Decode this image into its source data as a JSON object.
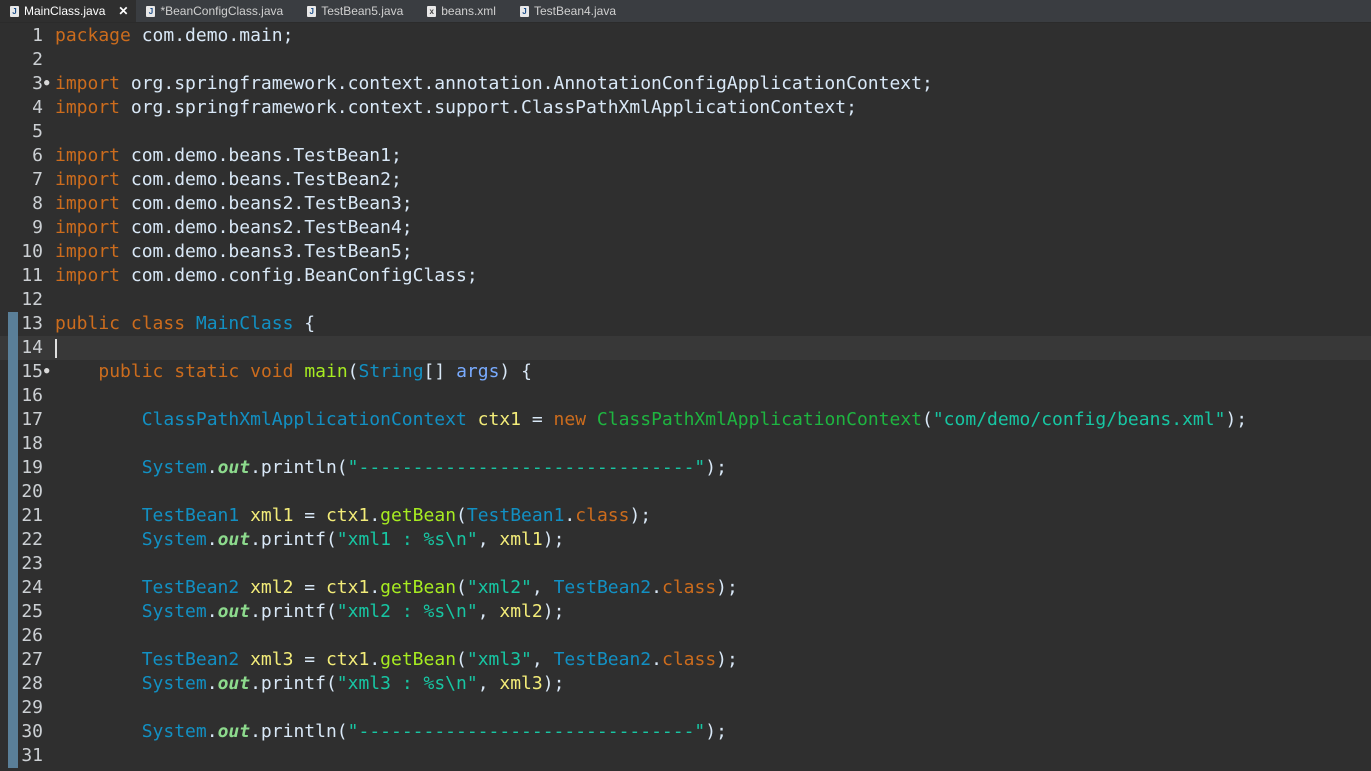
{
  "tabs": [
    {
      "label": "MainClass.java",
      "icon": "java-file-icon",
      "active": true
    },
    {
      "label": "*BeanConfigClass.java",
      "icon": "java-file-icon",
      "active": false
    },
    {
      "label": "TestBean5.java",
      "icon": "java-file-icon",
      "active": false
    },
    {
      "label": "beans.xml",
      "icon": "xml-file-icon",
      "active": false
    },
    {
      "label": "TestBean4.java",
      "icon": "java-file-icon",
      "active": false
    }
  ],
  "editor": {
    "current_line": 14,
    "lines": [
      {
        "n": "1",
        "tokens": [
          [
            "kw",
            "package"
          ],
          [
            "p",
            " com.demo.main;"
          ]
        ]
      },
      {
        "n": "2",
        "tokens": []
      },
      {
        "n": "3",
        "fold": true,
        "tokens": [
          [
            "kw",
            "import"
          ],
          [
            "p",
            " org.springframework.context.annotation.AnnotationConfigApplicationContext;"
          ]
        ]
      },
      {
        "n": "4",
        "tokens": [
          [
            "kw",
            "import"
          ],
          [
            "p",
            " org.springframework.context.support.ClassPathXmlApplicationContext;"
          ]
        ]
      },
      {
        "n": "5",
        "tokens": []
      },
      {
        "n": "6",
        "tokens": [
          [
            "kw",
            "import"
          ],
          [
            "p",
            " com.demo.beans.TestBean1;"
          ]
        ]
      },
      {
        "n": "7",
        "tokens": [
          [
            "kw",
            "import"
          ],
          [
            "p",
            " com.demo.beans.TestBean2;"
          ]
        ]
      },
      {
        "n": "8",
        "tokens": [
          [
            "kw",
            "import"
          ],
          [
            "p",
            " com.demo.beans2.TestBean3;"
          ]
        ]
      },
      {
        "n": "9",
        "tokens": [
          [
            "kw",
            "import"
          ],
          [
            "p",
            " com.demo.beans2.TestBean4;"
          ]
        ]
      },
      {
        "n": "10",
        "tokens": [
          [
            "kw",
            "import"
          ],
          [
            "p",
            " com.demo.beans3.TestBean5;"
          ]
        ]
      },
      {
        "n": "11",
        "tokens": [
          [
            "kw",
            "import"
          ],
          [
            "p",
            " com.demo.config.BeanConfigClass;"
          ]
        ]
      },
      {
        "n": "12",
        "tokens": []
      },
      {
        "n": "13",
        "tokens": [
          [
            "kw",
            "public"
          ],
          [
            "p",
            " "
          ],
          [
            "kw",
            "class"
          ],
          [
            "p",
            " "
          ],
          [
            "ty",
            "MainClass"
          ],
          [
            "p",
            " {"
          ]
        ]
      },
      {
        "n": "14",
        "tokens": []
      },
      {
        "n": "15",
        "fold": true,
        "tokens": [
          [
            "p",
            "    "
          ],
          [
            "kw",
            "public"
          ],
          [
            "p",
            " "
          ],
          [
            "kw",
            "static"
          ],
          [
            "p",
            " "
          ],
          [
            "kw",
            "void"
          ],
          [
            "p",
            " "
          ],
          [
            "fn",
            "main"
          ],
          [
            "p",
            "("
          ],
          [
            "ty",
            "String"
          ],
          [
            "p",
            "[] "
          ],
          [
            "arg",
            "args"
          ],
          [
            "p",
            ") {"
          ]
        ]
      },
      {
        "n": "16",
        "tokens": []
      },
      {
        "n": "17",
        "tokens": [
          [
            "p",
            "        "
          ],
          [
            "ty",
            "ClassPathXmlApplicationContext"
          ],
          [
            "p",
            " "
          ],
          [
            "var",
            "ctx1"
          ],
          [
            "p",
            " = "
          ],
          [
            "kw",
            "new"
          ],
          [
            "p",
            " "
          ],
          [
            "cls",
            "ClassPathXmlApplicationContext"
          ],
          [
            "p",
            "("
          ],
          [
            "str",
            "\"com/demo/config/beans.xml\""
          ],
          [
            "p",
            ");"
          ]
        ]
      },
      {
        "n": "18",
        "tokens": []
      },
      {
        "n": "19",
        "tokens": [
          [
            "p",
            "        "
          ],
          [
            "ty",
            "System"
          ],
          [
            "p",
            "."
          ],
          [
            "fld",
            "out"
          ],
          [
            "p",
            ".println("
          ],
          [
            "str",
            "\"-------------------------------\""
          ],
          [
            "p",
            ");"
          ]
        ]
      },
      {
        "n": "20",
        "tokens": []
      },
      {
        "n": "21",
        "tokens": [
          [
            "p",
            "        "
          ],
          [
            "ty",
            "TestBean1"
          ],
          [
            "p",
            " "
          ],
          [
            "var",
            "xml1"
          ],
          [
            "p",
            " = "
          ],
          [
            "var",
            "ctx1"
          ],
          [
            "p",
            "."
          ],
          [
            "fn",
            "getBean"
          ],
          [
            "p",
            "("
          ],
          [
            "ty",
            "TestBean1"
          ],
          [
            "p",
            "."
          ],
          [
            "kw",
            "class"
          ],
          [
            "p",
            ");"
          ]
        ]
      },
      {
        "n": "22",
        "tokens": [
          [
            "p",
            "        "
          ],
          [
            "ty",
            "System"
          ],
          [
            "p",
            "."
          ],
          [
            "fld",
            "out"
          ],
          [
            "p",
            ".printf("
          ],
          [
            "str",
            "\"xml1 : %s\\n\""
          ],
          [
            "p",
            ", "
          ],
          [
            "var",
            "xml1"
          ],
          [
            "p",
            ");"
          ]
        ]
      },
      {
        "n": "23",
        "tokens": []
      },
      {
        "n": "24",
        "tokens": [
          [
            "p",
            "        "
          ],
          [
            "ty",
            "TestBean2"
          ],
          [
            "p",
            " "
          ],
          [
            "var",
            "xml2"
          ],
          [
            "p",
            " = "
          ],
          [
            "var",
            "ctx1"
          ],
          [
            "p",
            "."
          ],
          [
            "fn",
            "getBean"
          ],
          [
            "p",
            "("
          ],
          [
            "str",
            "\"xml2\""
          ],
          [
            "p",
            ", "
          ],
          [
            "ty",
            "TestBean2"
          ],
          [
            "p",
            "."
          ],
          [
            "kw",
            "class"
          ],
          [
            "p",
            ");"
          ]
        ]
      },
      {
        "n": "25",
        "tokens": [
          [
            "p",
            "        "
          ],
          [
            "ty",
            "System"
          ],
          [
            "p",
            "."
          ],
          [
            "fld",
            "out"
          ],
          [
            "p",
            ".printf("
          ],
          [
            "str",
            "\"xml2 : %s\\n\""
          ],
          [
            "p",
            ", "
          ],
          [
            "var",
            "xml2"
          ],
          [
            "p",
            ");"
          ]
        ]
      },
      {
        "n": "26",
        "tokens": []
      },
      {
        "n": "27",
        "tokens": [
          [
            "p",
            "        "
          ],
          [
            "ty",
            "TestBean2"
          ],
          [
            "p",
            " "
          ],
          [
            "var",
            "xml3"
          ],
          [
            "p",
            " = "
          ],
          [
            "var",
            "ctx1"
          ],
          [
            "p",
            "."
          ],
          [
            "fn",
            "getBean"
          ],
          [
            "p",
            "("
          ],
          [
            "str",
            "\"xml3\""
          ],
          [
            "p",
            ", "
          ],
          [
            "ty",
            "TestBean2"
          ],
          [
            "p",
            "."
          ],
          [
            "kw",
            "class"
          ],
          [
            "p",
            ");"
          ]
        ]
      },
      {
        "n": "28",
        "tokens": [
          [
            "p",
            "        "
          ],
          [
            "ty",
            "System"
          ],
          [
            "p",
            "."
          ],
          [
            "fld",
            "out"
          ],
          [
            "p",
            ".printf("
          ],
          [
            "str",
            "\"xml3 : %s\\n\""
          ],
          [
            "p",
            ", "
          ],
          [
            "var",
            "xml3"
          ],
          [
            "p",
            ");"
          ]
        ]
      },
      {
        "n": "29",
        "tokens": []
      },
      {
        "n": "30",
        "tokens": [
          [
            "p",
            "        "
          ],
          [
            "ty",
            "System"
          ],
          [
            "p",
            "."
          ],
          [
            "fld",
            "out"
          ],
          [
            "p",
            ".println("
          ],
          [
            "str",
            "\"-------------------------------\""
          ],
          [
            "p",
            ");"
          ]
        ]
      },
      {
        "n": "31",
        "tokens": []
      }
    ]
  }
}
